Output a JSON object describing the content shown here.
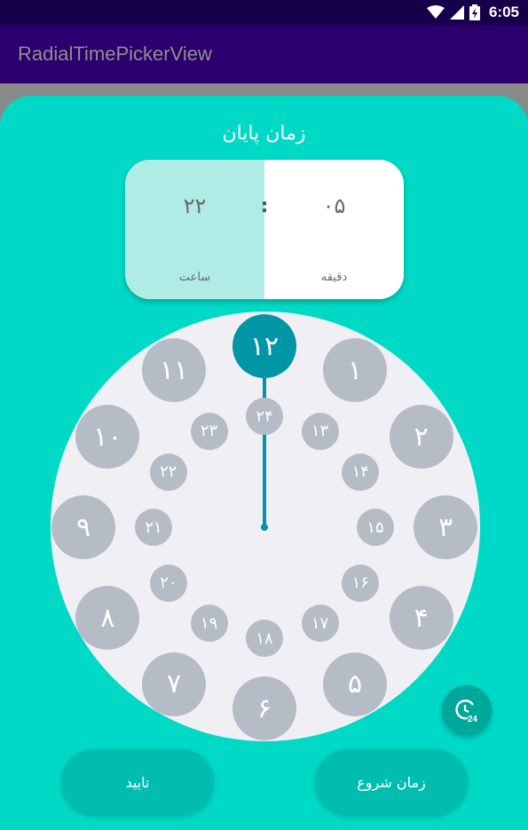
{
  "status_bar": {
    "time": "6:05",
    "icons": [
      "wifi-icon",
      "signal-icon",
      "battery-icon"
    ]
  },
  "app_bar": {
    "title": "RadialTimePickerView"
  },
  "dialog": {
    "title": "زمان پایان",
    "hour": {
      "value": "۲۲",
      "label": "ساعت"
    },
    "separator": ":",
    "minute": {
      "value": "۰۵",
      "label": "دقیقه"
    }
  },
  "clock": {
    "selected": "۱۲",
    "outer": [
      "۱۲",
      "۱",
      "۲",
      "۳",
      "۴",
      "۵",
      "۶",
      "۷",
      "۸",
      "۹",
      "۱۰",
      "۱۱"
    ],
    "inner": [
      "۲۴",
      "۱۳",
      "۱۴",
      "۱۵",
      "۱۶",
      "۱۷",
      "۱۸",
      "۱۹",
      "۲۰",
      "۲۱",
      "۲۲",
      "۲۳"
    ],
    "mode_button_icon": "clock-24-icon",
    "mode_button_text": "24"
  },
  "buttons": {
    "confirm": "تایید",
    "start_time": "زمان شروع"
  },
  "colors": {
    "accent": "#0096a6",
    "background": "#00d9c6",
    "app_bar": "#2b006e",
    "status_bar": "#16004a",
    "number_bubble": "#b5bcc6"
  }
}
